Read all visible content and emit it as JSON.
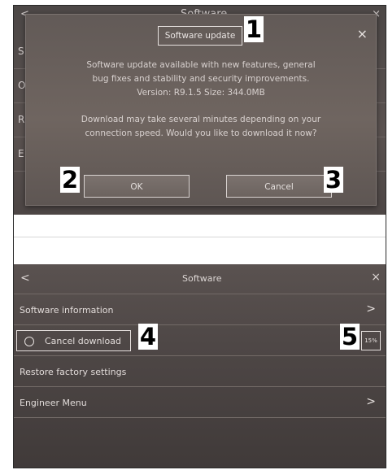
{
  "dialog_screen": {
    "background": {
      "back": "<",
      "title": "Software",
      "close": "×",
      "rows": [
        "S",
        "O",
        "R",
        "E"
      ]
    },
    "dialog": {
      "title": "Software update",
      "close": "×",
      "message_1": "Software update available with new features, general bug fixes and stability and security improvements. Version: R9.1.5 Size: 344.0MB",
      "message_2": "Download may take several minutes depending on your connection speed. Would you like to download it now?",
      "ok_label": "OK",
      "cancel_label": "Cancel"
    }
  },
  "software_screen": {
    "back": "<",
    "title": "Software",
    "close": "×",
    "items": [
      {
        "label": "Software information",
        "chevron": ">"
      },
      {
        "label": "Cancel download",
        "progress": "15%"
      },
      {
        "label": "Restore factory settings"
      },
      {
        "label": "Engineer Menu",
        "chevron": ">"
      }
    ]
  },
  "callouts": [
    "1",
    "2",
    "3",
    "4",
    "5"
  ],
  "colors": {
    "panel": "#5a5250",
    "dialog": "#6a615d",
    "text": "#e1dbd9"
  }
}
